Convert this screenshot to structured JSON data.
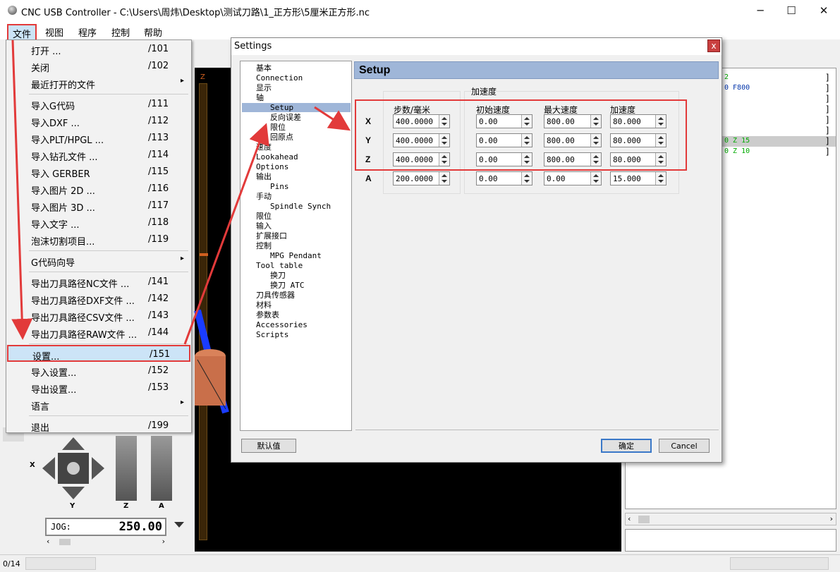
{
  "window": {
    "title": "CNC USB Controller - C:\\Users\\周炜\\Desktop\\测试刀路\\1_正方形\\5厘米正方形.nc",
    "minimize": "─",
    "maximize": "☐",
    "close": "✕"
  },
  "menubar": [
    "文件",
    "视图",
    "程序",
    "控制",
    "帮助"
  ],
  "file_menu": [
    {
      "label": "打开 ...",
      "shortcut": "/101"
    },
    {
      "label": "关闭",
      "shortcut": "/102"
    },
    {
      "label": "最近打开的文件",
      "shortcut": "",
      "submenu": "▸"
    },
    {
      "label": "导入G代码",
      "shortcut": "/111"
    },
    {
      "label": "导入DXF ...",
      "shortcut": "/112"
    },
    {
      "label": "导入PLT/HPGL ...",
      "shortcut": "/113"
    },
    {
      "label": "导入钻孔文件 ...",
      "shortcut": "/114"
    },
    {
      "label": "导入 GERBER",
      "shortcut": "/115"
    },
    {
      "label": "导入图片 2D ...",
      "shortcut": "/116"
    },
    {
      "label": "导入图片 3D ...",
      "shortcut": "/117"
    },
    {
      "label": "导入文字 ...",
      "shortcut": "/118"
    },
    {
      "label": "泡沫切割项目...",
      "shortcut": "/119"
    },
    {
      "label": "G代码向导",
      "shortcut": "",
      "submenu": "▸"
    },
    {
      "label": "导出刀具路径NC文件 ...",
      "shortcut": "/141"
    },
    {
      "label": "导出刀具路径DXF文件 ...",
      "shortcut": "/142"
    },
    {
      "label": "导出刀具路径CSV文件 ...",
      "shortcut": "/143"
    },
    {
      "label": "导出刀具路径RAW文件 ...",
      "shortcut": "/144"
    },
    {
      "label": "设置...",
      "shortcut": "/151"
    },
    {
      "label": "导入设置...",
      "shortcut": "/152"
    },
    {
      "label": "导出设置...",
      "shortcut": "/153"
    },
    {
      "label": "语言",
      "shortcut": "",
      "submenu": "▸"
    },
    {
      "label": "退出",
      "shortcut": "/199"
    }
  ],
  "dialog": {
    "title": "Settings",
    "close": "x",
    "header": "Setup",
    "tree": [
      "基本",
      "Connection",
      "显示",
      "轴",
      "Setup",
      "反向误差",
      "限位",
      "回原点",
      "速度",
      "Lookahead",
      "Options",
      "输出",
      "Pins",
      "手动",
      "Spindle Synch",
      "限位",
      "输入",
      "扩展接口",
      "控制",
      "MPG Pendant",
      "Tool table",
      "换刀",
      "换刀 ATC",
      "刀具传感器",
      "材料",
      "参数表",
      "Accessories",
      "Scripts"
    ],
    "group_title": "加速度",
    "columns": [
      "步数/毫米",
      "初始速度",
      "最大速度",
      "加速度"
    ],
    "axes": [
      {
        "name": "X",
        "values": [
          "400.0000",
          "0.00",
          "800.00",
          "80.000"
        ]
      },
      {
        "name": "Y",
        "values": [
          "400.0000",
          "0.00",
          "800.00",
          "80.000"
        ]
      },
      {
        "name": "Z",
        "values": [
          "400.0000",
          "0.00",
          "800.00",
          "80.000"
        ]
      },
      {
        "name": "A",
        "values": [
          "200.0000",
          "0.00",
          "0.00",
          "15.000"
        ]
      }
    ],
    "btn_default": "默认值",
    "btn_ok": "确定",
    "btn_cancel": "Cancel"
  },
  "code_lines": [
    "2",
    "0 F800",
    "",
    "",
    "",
    "",
    "0 Z 15",
    "0 Z 10"
  ],
  "jog": {
    "label": "JOG:",
    "value": "250.00"
  },
  "axis_labels": {
    "x": "X",
    "y": "Y",
    "z": "Z",
    "a": "A"
  },
  "z_label": "Z",
  "status": {
    "left": "0/14"
  },
  "colors": {
    "highlight": "#e23a3a",
    "selection": "#cce4f7",
    "header": "#9fb6d8"
  }
}
